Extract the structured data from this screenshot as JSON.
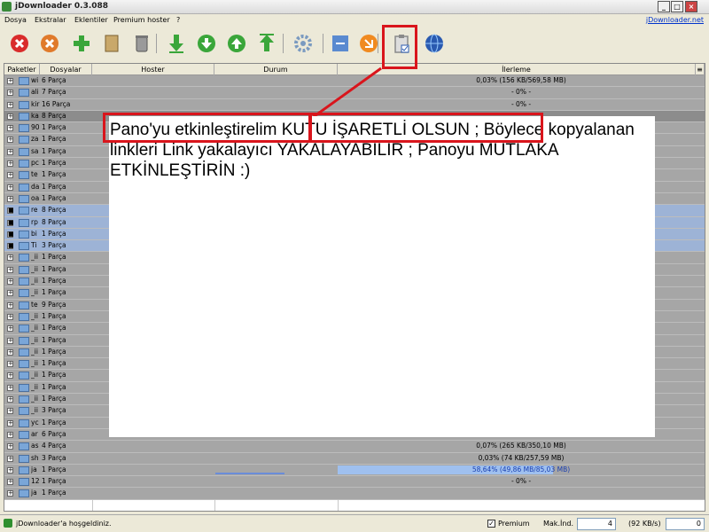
{
  "window": {
    "title": "jDownloader 0.3.088",
    "controls": [
      "_",
      "□",
      "×"
    ]
  },
  "menu": {
    "items": [
      "Dosya",
      "Ekstralar",
      "Eklentiler",
      "Premium hoster",
      "?"
    ],
    "link": "jDownloader.net"
  },
  "toolbar": {
    "buttons": [
      {
        "icon": "stop-icon",
        "color": "#d92b2b"
      },
      {
        "icon": "cancel-icon",
        "color": "#e07a2b"
      },
      {
        "icon": "add-icon",
        "color": "#3aa63a"
      },
      {
        "icon": "package-icon",
        "color": "#c9a86a"
      },
      {
        "icon": "trash-icon",
        "color": "#9a9a9a"
      },
      {
        "icon": "download-icon",
        "color": "#3aa63a"
      },
      {
        "icon": "move-down-icon",
        "color": "#3aa63a"
      },
      {
        "icon": "move-up-icon",
        "color": "#3aa63a"
      },
      {
        "icon": "upload-icon",
        "color": "#3aa63a"
      },
      {
        "icon": "settings-icon",
        "color": "#7a9ac0"
      },
      {
        "icon": "reconnect-icon",
        "color": "#5a8ad0"
      },
      {
        "icon": "update-icon",
        "color": "#f08a20"
      },
      {
        "icon": "clipboard-icon",
        "color": "#8a8a8a"
      },
      {
        "icon": "globe-icon",
        "color": "#2a5ab0"
      }
    ]
  },
  "table": {
    "columns": [
      "Paketler",
      "Dosyalar",
      "Hoster",
      "Durum",
      "İlerleme"
    ],
    "rows": [
      {
        "name": "wi",
        "parts": "6 Parça",
        "progress": "0,03% (156 KB/569,58 MB)",
        "state": ""
      },
      {
        "name": "ali",
        "parts": "7 Parça",
        "progress": "- 0% -",
        "state": ""
      },
      {
        "name": "kir",
        "parts": "16 Parça",
        "progress": "- 0% -",
        "state": ""
      },
      {
        "name": "ka",
        "parts": "8 Parça",
        "progress": "",
        "state": "dark"
      },
      {
        "name": "90",
        "parts": "1 Parça",
        "progress": "",
        "state": ""
      },
      {
        "name": "za",
        "parts": "1 Parça",
        "progress": "",
        "state": ""
      },
      {
        "name": "sa",
        "parts": "1 Parça",
        "progress": "",
        "state": ""
      },
      {
        "name": "pc",
        "parts": "1 Parça",
        "progress": "",
        "state": ""
      },
      {
        "name": "te",
        "parts": "1 Parça",
        "progress": "",
        "state": ""
      },
      {
        "name": "da",
        "parts": "1 Parça",
        "progress": "",
        "state": ""
      },
      {
        "name": "oa",
        "parts": "1 Parça",
        "progress": "",
        "state": ""
      },
      {
        "name": "re",
        "parts": "8 Parça",
        "progress": "",
        "state": "sel"
      },
      {
        "name": "rp",
        "parts": "8 Parça",
        "progress": "",
        "state": "sel"
      },
      {
        "name": "bi",
        "parts": "1 Parça",
        "progress": "",
        "state": "sel"
      },
      {
        "name": "Ti",
        "parts": "3 Parça",
        "progress": "",
        "state": "sel"
      },
      {
        "name": "_ii",
        "parts": "1 Parça",
        "progress": "",
        "state": ""
      },
      {
        "name": "_ii",
        "parts": "1 Parça",
        "progress": "",
        "state": ""
      },
      {
        "name": "_ii",
        "parts": "1 Parça",
        "progress": "",
        "state": ""
      },
      {
        "name": "_ii",
        "parts": "1 Parça",
        "progress": "",
        "state": ""
      },
      {
        "name": "te",
        "parts": "9 Parça",
        "progress": "",
        "state": ""
      },
      {
        "name": "_ii",
        "parts": "1 Parça",
        "progress": "",
        "state": ""
      },
      {
        "name": "_ii",
        "parts": "1 Parça",
        "progress": "",
        "state": ""
      },
      {
        "name": "_ii",
        "parts": "1 Parça",
        "progress": "",
        "state": ""
      },
      {
        "name": "_ii",
        "parts": "1 Parça",
        "progress": "",
        "state": ""
      },
      {
        "name": "_ii",
        "parts": "1 Parça",
        "progress": "",
        "state": ""
      },
      {
        "name": "_ii",
        "parts": "1 Parça",
        "progress": "",
        "state": ""
      },
      {
        "name": "_ii",
        "parts": "1 Parça",
        "progress": "",
        "state": ""
      },
      {
        "name": "_ii",
        "parts": "1 Parça",
        "progress": "",
        "state": ""
      },
      {
        "name": "_ii",
        "parts": "3 Parça",
        "progress": "",
        "state": ""
      },
      {
        "name": "yc",
        "parts": "1 Parça",
        "progress": "- 0% -",
        "state": ""
      },
      {
        "name": "ar",
        "parts": "6 Parça",
        "progress": "- 0% -",
        "state": ""
      },
      {
        "name": "as",
        "parts": "4 Parça",
        "progress": "0,07% (265 KB/350,10 MB)",
        "state": ""
      },
      {
        "name": "sh",
        "parts": "3 Parça",
        "progress": "0,03% (74 KB/257,59 MB)",
        "state": ""
      },
      {
        "name": "ja",
        "parts": "1 Parça",
        "progress": "58,64% (49,86 MB/85,03 MB)",
        "state": "active",
        "fill": 0.5864
      },
      {
        "name": "12",
        "parts": "1 Parça",
        "progress": "- 0% -",
        "state": ""
      },
      {
        "name": "ja",
        "parts": "1 Parça",
        "progress": "",
        "state": ""
      }
    ]
  },
  "overlay": {
    "part1": "Pano'yu etkinleştirelim",
    "part2": "KUTU İŞARETLİ OLSUN",
    "part3": " ; Böylece kopyalanan linkleri Link yakalayıcı YAKALAYABİLİR ; Panoyu MUTLAKA ETKİNLEŞTİRİN :)"
  },
  "status": {
    "message": "jDownloader'a hoşgeldiniz.",
    "premium_checked": "✓",
    "premium_label": "Premium",
    "max_label": "Mak.İnd.",
    "max_value": "4",
    "speed_label": "(92 KB/s)",
    "speed_value": "0"
  },
  "colors": {
    "highlight": "#d9151c",
    "selected_row": "#9db3d6",
    "row": "#a6a6a6"
  }
}
